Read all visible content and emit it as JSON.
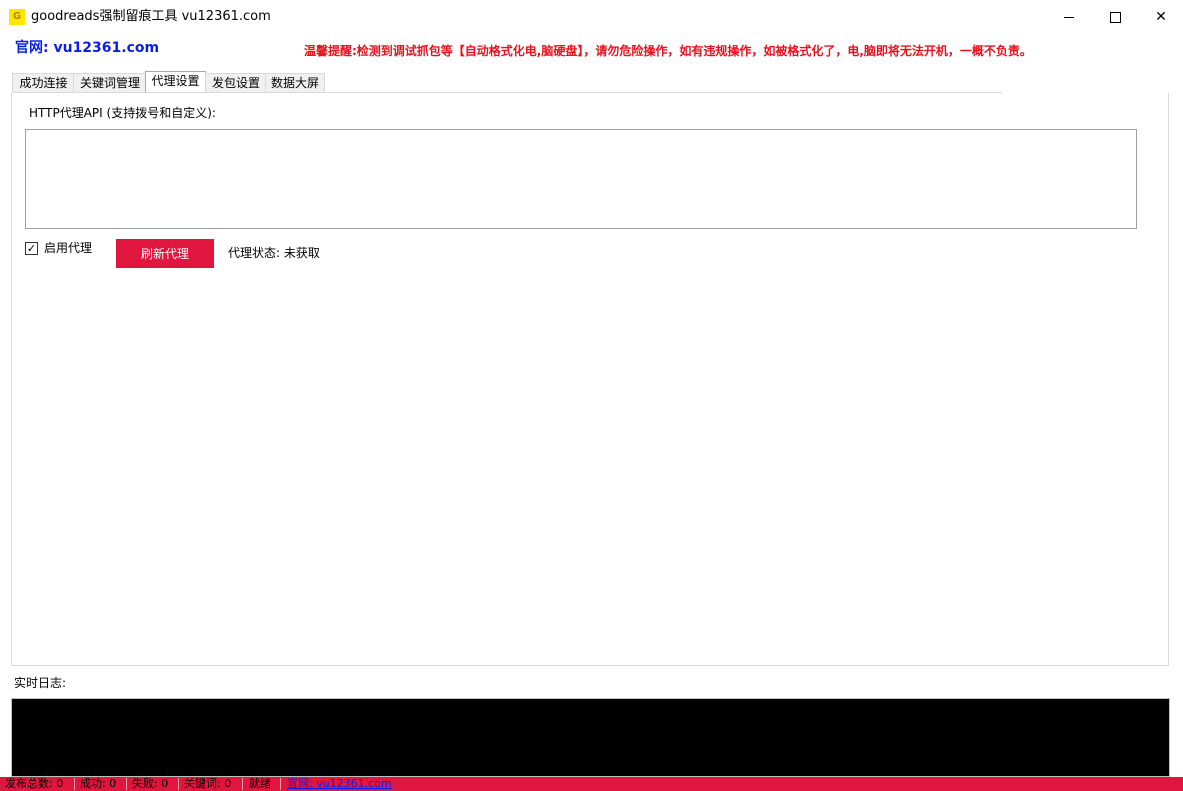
{
  "window": {
    "title": "goodreads强制留痕工具 vu12361.com",
    "icon_text": "G",
    "min_glyph": "",
    "max_glyph": "",
    "close_glyph": "✕"
  },
  "header": {
    "site_label": "官网: vu12361.com",
    "warning": "温馨提醒:检测到调试抓包等【自动格式化电,脑硬盘】，请勿危险操作，如有违规操作，如被格式化了，电,脑即将无法开机，一概不负责。"
  },
  "tabs": [
    {
      "label": "成功连接"
    },
    {
      "label": "关键词管理"
    },
    {
      "label": "代理设置"
    },
    {
      "label": "发包设置"
    },
    {
      "label": "数据大屏"
    }
  ],
  "proxy": {
    "api_label": "HTTP代理API (支持拨号和自定义):",
    "api_value": "",
    "enable_label": "启用代理",
    "enable_checked": "✓",
    "refresh_label": "刷新代理",
    "status_text": "代理状态: 未获取"
  },
  "log": {
    "label": "实时日志:"
  },
  "statusbar": {
    "total": "发布总数: 0",
    "success": "成功: 0",
    "fail": "失败: 0",
    "keywords": "关键词: 0",
    "ready": "就绪",
    "site_link": "官网: vu12361.com"
  },
  "colors": {
    "accent_red": "#e0163e",
    "site_blue": "#0a1fe6",
    "warning_red": "#e8121e"
  }
}
